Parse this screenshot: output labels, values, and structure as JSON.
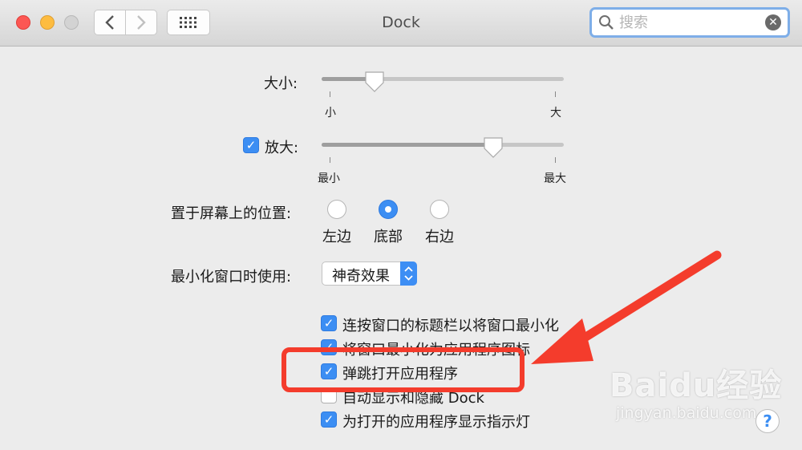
{
  "window": {
    "title": "Dock",
    "search": {
      "value": "",
      "placeholder": "搜索"
    }
  },
  "size": {
    "label": "大小:",
    "min_label": "小",
    "max_label": "大",
    "value_fraction": 0.22
  },
  "magnification": {
    "label": "放大:",
    "checked": true,
    "min_label": "最小",
    "max_label": "最大",
    "value_fraction": 0.71
  },
  "position": {
    "label": "置于屏幕上的位置:",
    "options": [
      {
        "label": "左边",
        "selected": false
      },
      {
        "label": "底部",
        "selected": true
      },
      {
        "label": "右边",
        "selected": false
      }
    ]
  },
  "minimize_effect": {
    "label": "最小化窗口时使用:",
    "selected": "神奇效果"
  },
  "options": [
    {
      "label": "连按窗口的标题栏以将窗口最小化",
      "checked": true
    },
    {
      "label": "将窗口最小化为应用程序图标",
      "checked": true
    },
    {
      "label": "弹跳打开应用程序",
      "checked": true
    },
    {
      "label": "自动显示和隐藏 Dock",
      "checked": false
    },
    {
      "label": "为打开的应用程序显示指示灯",
      "checked": true
    }
  ],
  "watermark": {
    "brand": "Baidu经验",
    "url": "jingyan.baidu.com"
  },
  "help": {
    "label": "?"
  },
  "colors": {
    "accent": "#3c8ef3",
    "annotation_red": "#f43c2c"
  }
}
